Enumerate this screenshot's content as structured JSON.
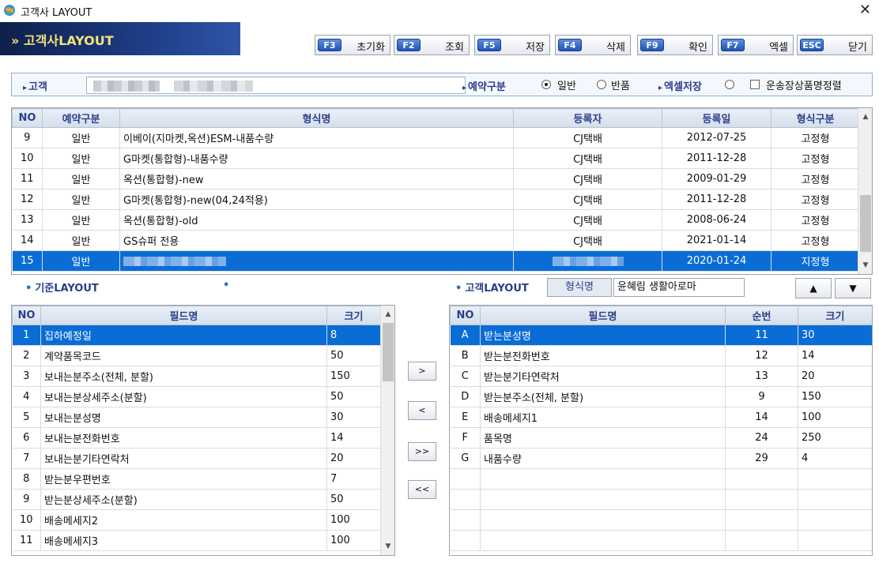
{
  "window": {
    "title": "고객사 LAYOUT",
    "icon": "app-globe-icon",
    "close": "✕"
  },
  "banner": {
    "title": "» 고객사LAYOUT"
  },
  "toolbar": {
    "buttons": [
      {
        "key": "F3",
        "label": "초기화"
      },
      {
        "key": "F2",
        "label": "조회"
      },
      {
        "key": "F5",
        "label": "저장"
      },
      {
        "key": "F4",
        "label": "삭제"
      },
      {
        "key": "F9",
        "label": "확인"
      },
      {
        "key": "F7",
        "label": "엑셀"
      },
      {
        "key": "ESC",
        "label": "닫기"
      }
    ]
  },
  "search": {
    "customer_label": "고객",
    "reservation_label": "예약구분",
    "opt_normal": "일반",
    "opt_return": "반품",
    "excel_label": "엑셀저장",
    "sort_label": "운송장상품명정렬",
    "selected": "일반"
  },
  "formats": {
    "headers": [
      "NO",
      "예약구분",
      "형식명",
      "등록자",
      "등록일",
      "형식구분"
    ],
    "rows": [
      [
        "9",
        "일반",
        "이베이(지마켓,옥션)ESM-내품수량",
        "CJ택배",
        "2012-07-25",
        "고정형"
      ],
      [
        "10",
        "일반",
        "G마켓(통합형)-내품수량",
        "CJ택배",
        "2011-12-28",
        "고정형"
      ],
      [
        "11",
        "일반",
        "옥션(통합형)-new",
        "CJ택배",
        "2009-01-29",
        "고정형"
      ],
      [
        "12",
        "일반",
        "G마켓(통합형)-new(04,24적용)",
        "CJ택배",
        "2011-12-28",
        "고정형"
      ],
      [
        "13",
        "일반",
        "옥션(통합형)-old",
        "CJ택배",
        "2008-06-24",
        "고정형"
      ],
      [
        "14",
        "일반",
        "GS슈퍼 전용",
        "CJ택배",
        "2021-01-14",
        "고정형"
      ],
      [
        "15",
        "일반",
        "",
        "",
        "2020-01-24",
        "지정형"
      ]
    ],
    "selected_index": 6
  },
  "base_layout": {
    "label": "기준LAYOUT",
    "headers": [
      "NO",
      "필드명",
      "크기"
    ],
    "rows": [
      [
        "1",
        "집하예정일",
        "8"
      ],
      [
        "2",
        "계약품목코드",
        "50"
      ],
      [
        "3",
        "보내는분주소(전체, 분할)",
        "150"
      ],
      [
        "4",
        "보내는분상세주소(분할)",
        "50"
      ],
      [
        "5",
        "보내는분성명",
        "30"
      ],
      [
        "6",
        "보내는분전화번호",
        "14"
      ],
      [
        "7",
        "보내는분기타연락처",
        "20"
      ],
      [
        "8",
        "받는분우편번호",
        "7"
      ],
      [
        "9",
        "받는분상세주소(분할)",
        "50"
      ],
      [
        "10",
        "배송메세지2",
        "100"
      ],
      [
        "11",
        "배송메세지3",
        "100"
      ]
    ],
    "selected_index": 0
  },
  "move_buttons": [
    ">",
    "<",
    ">>",
    "<<"
  ],
  "customer_layout": {
    "label": "고객LAYOUT",
    "format_label": "형식명",
    "format_value": "윤혜림 생활아로마",
    "up": "▲",
    "down": "▼",
    "headers": [
      "NO",
      "필드명",
      "순번",
      "크기"
    ],
    "rows": [
      [
        "A",
        "받는분성명",
        "11",
        "30"
      ],
      [
        "B",
        "받는분전화번호",
        "12",
        "14"
      ],
      [
        "C",
        "받는분기타연락처",
        "13",
        "20"
      ],
      [
        "D",
        "받는분주소(전체, 분할)",
        "9",
        "150"
      ],
      [
        "E",
        "배송메세지1",
        "14",
        "100"
      ],
      [
        "F",
        "품목명",
        "24",
        "250"
      ],
      [
        "G",
        "내품수량",
        "29",
        "4"
      ]
    ],
    "empty_rows": 4,
    "selected_index": 0
  }
}
